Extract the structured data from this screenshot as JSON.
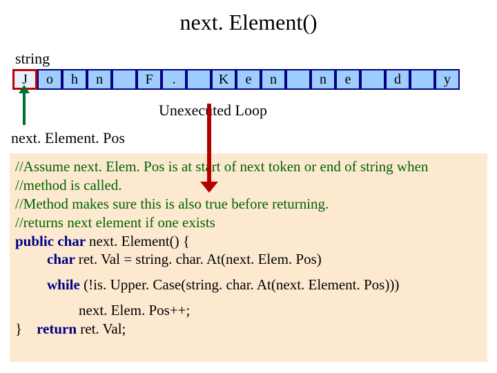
{
  "title": "next. Element()",
  "string_label": "string",
  "unexecuted_label": "Unexecuted Loop",
  "next_element_pos_label": "next. Element. Pos",
  "cells": [
    "J",
    "o",
    "h",
    "n",
    "",
    "F",
    ".",
    "",
    "K",
    "e",
    "n",
    "",
    "n",
    "e",
    "",
    "d",
    "",
    "y"
  ],
  "code": {
    "c1": "//Assume next. Elem. Pos is at start of next token or end of string when",
    "c2": "//method is called.",
    "c3": "//Method makes sure this is also true before returning.",
    "c4": "//returns next element if one exists",
    "sig_pre": "public char ",
    "sig_name": "next. Element() {",
    "retdecl_pre": "char ",
    "retdecl_rest": "ret. Val =  string. char. At(next. Elem. Pos)",
    "while_kw": "while ",
    "while_rest": "(!is. Upper. Case(string. char. At(next. Element. Pos)))",
    "inc": "next. Elem. Pos++;",
    "ret_kw": "return ",
    "ret_rest": "ret. Val;",
    "close": "}"
  }
}
